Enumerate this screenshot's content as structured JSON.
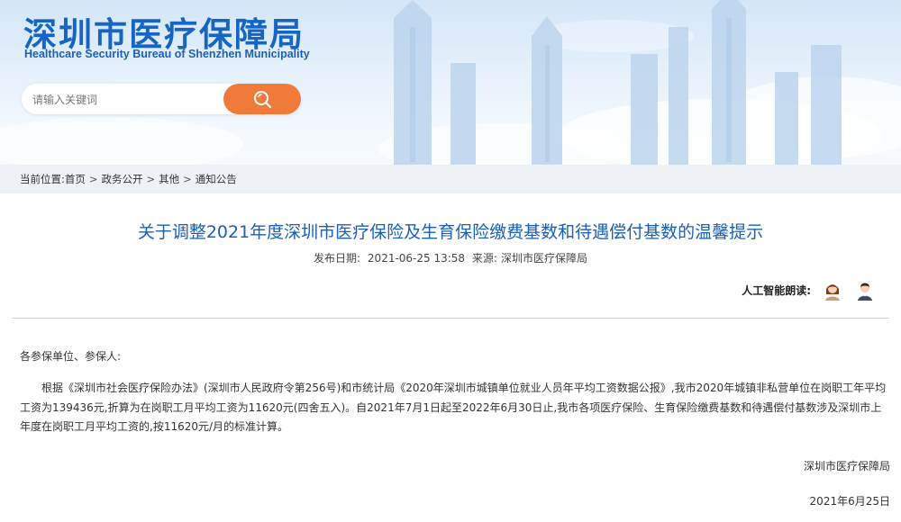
{
  "header": {
    "org_name_cn": "深圳市医疗保障局",
    "org_name_en": "Healthcare Security Bureau of Shenzhen Municipality",
    "search": {
      "placeholder": "请输入关键词",
      "button_icon": "search-icon"
    }
  },
  "breadcrumb": {
    "label": "当前位置:",
    "separator": ">",
    "items": [
      "首页",
      "政务公开",
      "其他",
      "通知公告"
    ]
  },
  "article": {
    "title": "关于调整2021年度深圳市医疗保险及生育保险缴费基数和待遇偿付基数的温馨提示",
    "publish_label": "发布日期:",
    "publish_date": "2021-06-25 13:58",
    "source_label": "来源:",
    "source": "深圳市医疗保障局",
    "ai_reader_label": "人工智能朗读:",
    "reader_icons": [
      "female-reader-icon",
      "male-reader-icon"
    ],
    "salutation": "各参保单位、参保人:",
    "body": "根据《深圳市社会医疗保险办法》(深圳市人民政府令第256号)和市统计局《2020年深圳市城镇单位就业人员年平均工资数据公报》,我市2020年城镇非私营单位在岗职工年平均工资为139436元,折算为在岗职工月平均工资为11620元(四舍五入)。自2021年7月1日起至2022年6月30日止,我市各项医疗保险、生育保险缴费基数和待遇偿付基数涉及深圳市上年度在岗职工月平均工资的,按11620元/月的标准计算。",
    "signature_org": "深圳市医疗保障局",
    "signature_date": "2021年6月25日"
  },
  "colors": {
    "brand_blue": "#1664c4",
    "title_blue": "#1a5fb8",
    "search_orange": "#f07a3a",
    "breadcrumb_bg": "#eef1f5"
  }
}
